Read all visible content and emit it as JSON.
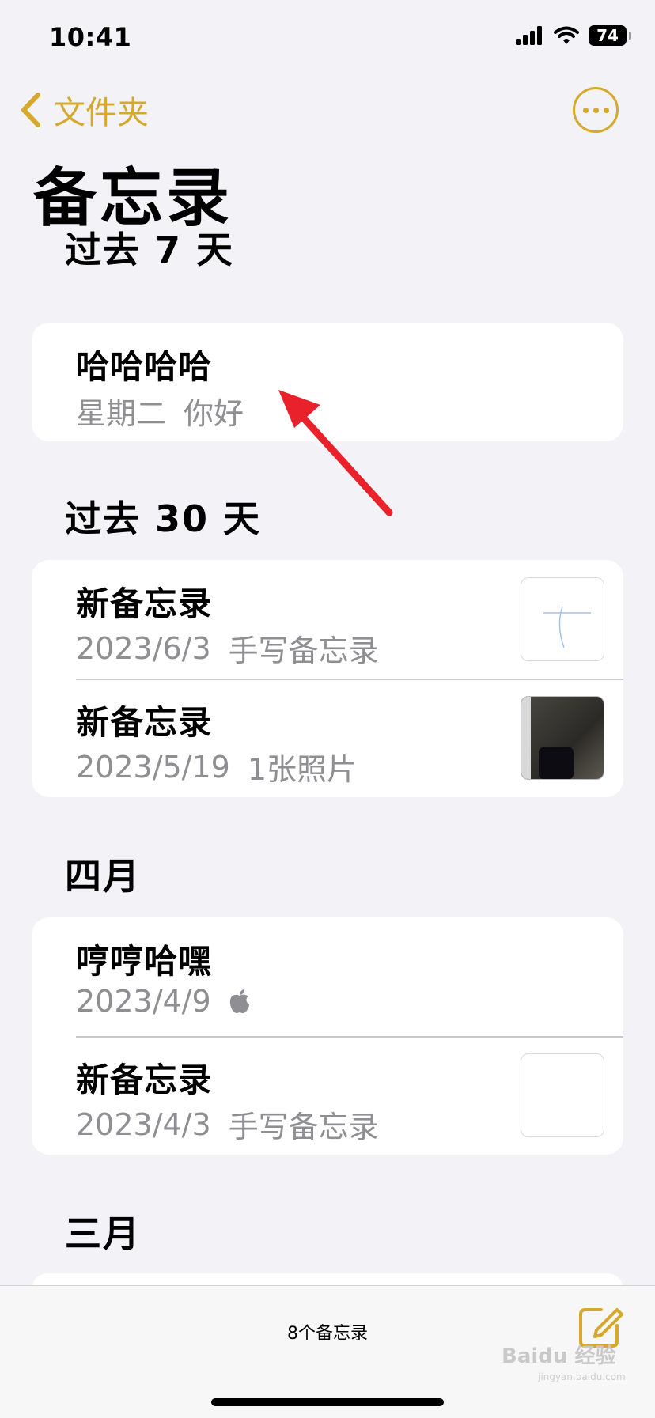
{
  "status_bar": {
    "time": "10:41",
    "battery": "74"
  },
  "nav": {
    "back_label": "文件夹"
  },
  "page_title": "备忘录",
  "sections": [
    {
      "header": "过去 7 天",
      "notes": [
        {
          "title": "哈哈哈哈",
          "date": "星期二",
          "preview": "你好"
        }
      ]
    },
    {
      "header": "过去 30 天",
      "notes": [
        {
          "title": "新备忘录",
          "date": "2023/6/3",
          "preview": "手写备忘录"
        },
        {
          "title": "新备忘录",
          "date": "2023/5/19",
          "preview": "1张照片"
        }
      ]
    },
    {
      "header": "四月",
      "notes": [
        {
          "title": "哼哼哈嘿",
          "date": "2023/4/9",
          "preview_icon": "apple-icon"
        },
        {
          "title": "新备忘录",
          "date": "2023/4/3",
          "preview": "手写备忘录"
        }
      ]
    },
    {
      "header": "三月"
    }
  ],
  "toolbar": {
    "note_count": "8个备忘录"
  },
  "watermark": {
    "text": "Baidu 经验",
    "sub": "jingyan.baidu.com"
  },
  "colors": {
    "accent": "#d6a92c",
    "arrow": "#e8212b",
    "background": "#f2f2f7"
  }
}
